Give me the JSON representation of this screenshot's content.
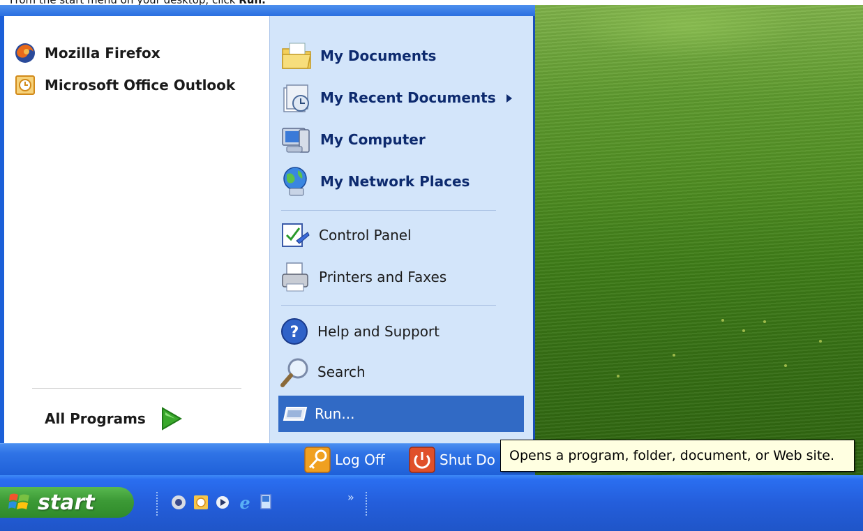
{
  "instruction": {
    "prefix": "From the start menu on your desktop, click ",
    "target": "Run."
  },
  "left_pane": {
    "pinned": [
      {
        "label": "Mozilla Firefox",
        "icon": "firefox-icon"
      },
      {
        "label": "Microsoft Office Outlook",
        "icon": "outlook-icon"
      }
    ],
    "all_programs": "All Programs"
  },
  "right_pane": {
    "items": [
      {
        "label": "My Documents",
        "icon": "my-documents-icon"
      },
      {
        "label": "My Recent Documents",
        "icon": "recent-documents-icon"
      },
      {
        "label": "My Computer",
        "icon": "my-computer-icon"
      },
      {
        "label": "My Network Places",
        "icon": "network-places-icon"
      },
      {
        "label": "Control Panel",
        "icon": "control-panel-icon"
      },
      {
        "label": "Printers and Faxes",
        "icon": "printer-icon"
      },
      {
        "label": "Help and Support",
        "icon": "help-icon"
      },
      {
        "label": "Search",
        "icon": "search-icon"
      },
      {
        "label": "Run...",
        "icon": "run-icon"
      }
    ]
  },
  "bottom_bar": {
    "log_off": "Log Off",
    "shut_down": "Shut Do"
  },
  "tooltip": "Opens a program, folder, document, or Web site.",
  "taskbar": {
    "start": "start",
    "overflow": "»"
  },
  "colors": {
    "menu_blue": "#1b5fd8",
    "right_pane": "#d3e5fa",
    "highlight": "#316ac5",
    "tooltip_bg": "#ffffe1",
    "start_green": "#3c9a36"
  }
}
